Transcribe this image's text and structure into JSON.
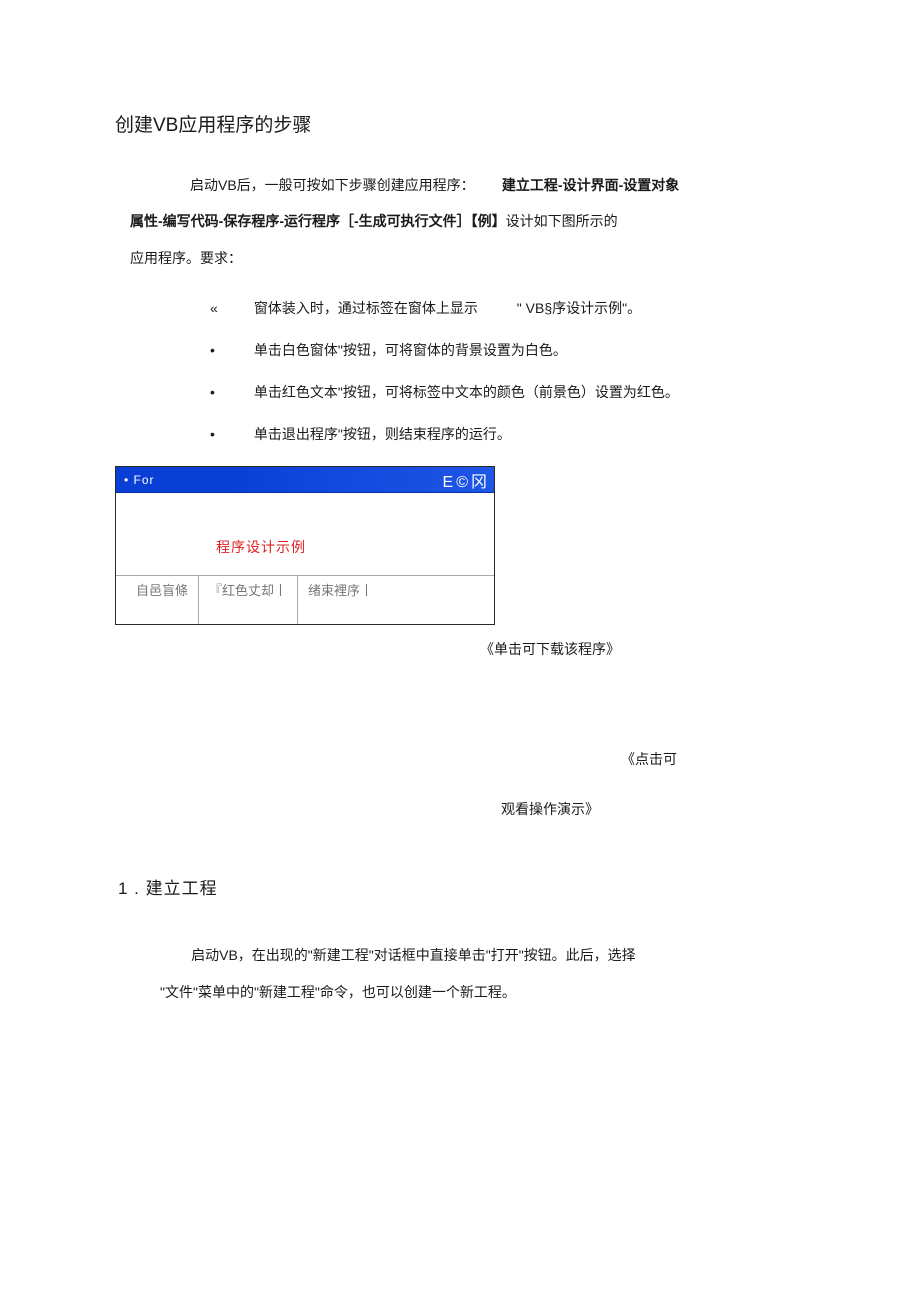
{
  "title": "创建VB应用程序的步骤",
  "intro": {
    "p1a": "启动VB后，一般可按如下步骤创建应用程序：",
    "p1b": "建立工程-设计界面-设置对象",
    "p2a": "属性-编写代码-保存程序-运行程序［-生成可执行文件］【例】",
    "p2b": "设计如下图所示的",
    "p3": "应用程序。要求："
  },
  "bullets": {
    "b1_mark": "«",
    "b1_a": "窗体装入时，通过标签在窗体上显示",
    "b1_b": "\" VB§序设计示例\"。",
    "b2_mark": "•",
    "b2": "单击白色窗体\"按钮，可将窗体的背景设置为白色。",
    "b3_mark": "•",
    "b3": "单击红色文本\"按钮，可将标签中文本的颜色（前景色）设置为红色。",
    "b4_mark": "•",
    "b4": "单击退出程序\"按钮，则结束程序的运行。"
  },
  "window": {
    "title_left": "• For",
    "title_right": "E©冈",
    "label": "程序设计示例",
    "btn1": "自邑盲條",
    "btn2": "『红色丈却丨",
    "btn3": "绪束裡序丨"
  },
  "captions": {
    "c1": "《单击可下载该程序》",
    "c2": "《点击可",
    "c3": "观看操作演示》"
  },
  "section": {
    "head": "1 . 建立工程",
    "p1": "启动VB，在出现的\"新建工程\"对话框中直接单击\"打开\"按钮。此后，选择",
    "p2": "\"文件\"菜单中的\"新建工程\"命令，也可以创建一个新工程。"
  }
}
